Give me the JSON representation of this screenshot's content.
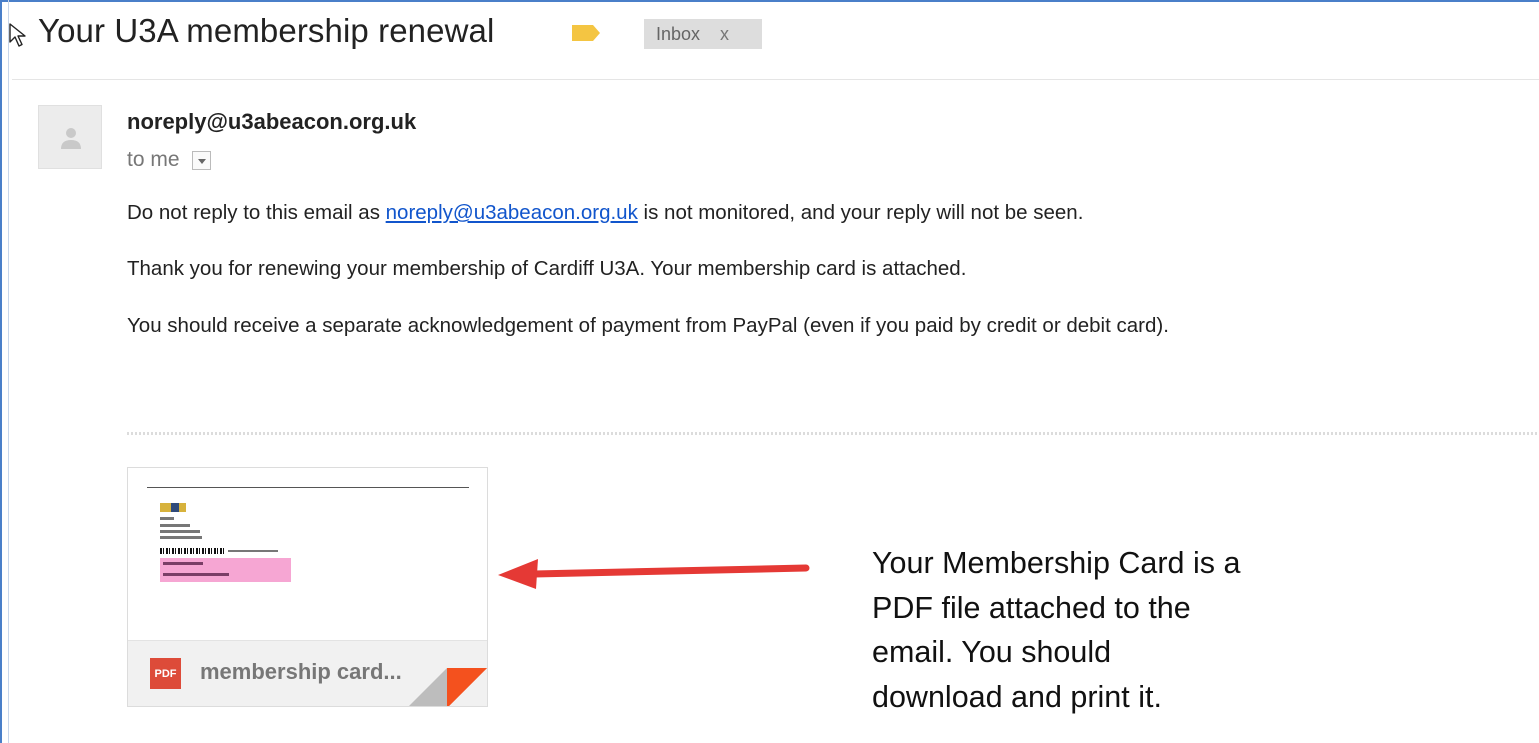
{
  "email": {
    "subject": "Your U3A membership renewal",
    "label_chip": {
      "text": "Inbox",
      "close": "x"
    },
    "label_color": "#f4c542",
    "sender": "noreply@u3abeacon.org.uk",
    "recipient": "to me",
    "body": {
      "line1_prefix": "Do not reply to this email as ",
      "line1_link": "noreply@u3abeacon.org.uk",
      "line1_suffix": " is not monitored, and your reply will not be seen.",
      "line2": "Thank you for renewing your membership of Cardiff U3A. Your membership card is attached.",
      "line3": "You should receive a separate acknowledgement of payment from PayPal (even if you paid by credit or debit card)."
    },
    "attachment": {
      "icon_label": "PDF",
      "filename": "membership card..."
    }
  },
  "annotation": {
    "lines": [
      "Your Membership Card is a",
      "PDF file attached to the",
      "email. You should",
      "download and print it."
    ],
    "arrow_color": "#e53935"
  },
  "icons": {
    "cursor": "mouse-pointer-icon",
    "label": "label-tag-icon",
    "avatar": "default-avatar-icon",
    "dropdown": "chevron-down-icon",
    "pdf": "pdf-file-icon",
    "arrow": "arrow-left-icon"
  }
}
